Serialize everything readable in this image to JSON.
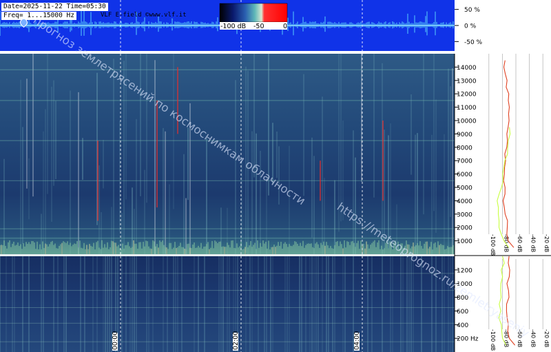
{
  "header": {
    "date_line": "Date=2025-11-22 Time=05:30",
    "freq_line": "Freq= 1...15000 Hz",
    "source": "VLF E-field ©www.vlf.it"
  },
  "colorbar": {
    "tick_labels": [
      "-100 dB",
      "-50",
      "0"
    ],
    "colors": [
      "#000000",
      "#0a1a6e",
      "#2a5fb0",
      "#5fb8b8",
      "#d8e8d0",
      "#ff3030",
      "#ff0000"
    ]
  },
  "watermark": {
    "line1": "прогноз землетрясений по космоснимкам облачности",
    "line2": "https://meteoprognoz.ru/zemletryaseniy"
  },
  "chart_data": [
    {
      "type": "line",
      "title": "",
      "panel": "waveform",
      "ytick_labels": [
        "50 %",
        "0 %",
        "-50 %"
      ],
      "yticks": [
        50,
        0,
        -50
      ],
      "ylim": [
        -75,
        75
      ],
      "background": "#1033e8",
      "line_color": "#5fe0ff"
    },
    {
      "type": "heatmap",
      "panel": "spectrogram-full",
      "ylim": [
        0,
        15000
      ],
      "yticks": [
        1000,
        2000,
        3000,
        4000,
        5000,
        6000,
        7000,
        8000,
        9000,
        10000,
        11000,
        12000,
        13000,
        14000
      ],
      "ytick_labels": [
        "1000",
        "2000",
        "3000",
        "4000",
        "5000",
        "6000",
        "7000",
        "8000",
        "9000",
        "10000",
        "11000",
        "12000",
        "13000",
        "14000"
      ],
      "time_marks": [
        "00:00",
        "02:00",
        "04:00"
      ]
    },
    {
      "type": "heatmap",
      "panel": "spectrogram-zoom",
      "ylim": [
        0,
        1400
      ],
      "yticks": [
        200,
        400,
        600,
        800,
        1000,
        1200
      ],
      "ytick_labels": [
        "200 Hz",
        "400",
        "600",
        "800",
        "1000",
        "1200"
      ],
      "xtick_labels": [
        "00:00",
        "02:00",
        "04:00"
      ]
    },
    {
      "type": "line",
      "panel": "spectrum-profile",
      "xtick_labels": [
        "-100 dB",
        "-80 dB",
        "-60 dB",
        "-40 dB",
        "-20 dB"
      ],
      "xticks": [
        -100,
        -80,
        -60,
        -40,
        -20
      ],
      "xlim": [
        -110,
        -10
      ],
      "series": [
        {
          "color": "#e04020",
          "freq": [
            500,
            1000,
            1500,
            2000,
            2500,
            3000,
            3500,
            4000,
            4500,
            5000,
            5500,
            6000,
            6500,
            7000,
            7500,
            8000,
            8500,
            9000,
            9500,
            10000,
            10500,
            11000,
            11500,
            12000,
            12500,
            13000,
            13500,
            14000,
            14500
          ],
          "db": [
            -64,
            -70,
            -72,
            -74,
            -74,
            -75,
            -76,
            -77,
            -77,
            -78,
            -77,
            -77,
            -76,
            -76,
            -75,
            -74,
            -73,
            -72,
            -72,
            -71,
            -71,
            -70,
            -71,
            -72,
            -73,
            -74,
            -75,
            -76,
            -77
          ]
        },
        {
          "color": "#c8ff40",
          "freq": [
            500,
            1000,
            1500,
            2000,
            2500,
            3000,
            3500,
            4000,
            4500,
            5000,
            5500,
            6000,
            6500,
            7000,
            7500,
            8000,
            8500,
            9000,
            9500
          ],
          "db": [
            -70,
            -76,
            -80,
            -83,
            -84,
            -86,
            -86,
            -87,
            -84,
            -82,
            -80,
            -79,
            -78,
            -76,
            -74,
            -71,
            -70,
            -70,
            -70
          ]
        }
      ]
    },
    {
      "type": "line",
      "panel": "spectrum-profile-zoom",
      "xtick_labels": [
        "-100 dB",
        "-80 dB",
        "-60 dB",
        "-40 dB",
        "-20 dB"
      ],
      "xticks": [
        -100,
        -80,
        -60,
        -40,
        -20
      ],
      "xlim": [
        -110,
        -10
      ],
      "series": [
        {
          "color": "#e04020",
          "freq": [
            100,
            200,
            300,
            400,
            500,
            600,
            700,
            800,
            900,
            1000,
            1100,
            1200,
            1300,
            1400
          ],
          "db": [
            -62,
            -70,
            -72,
            -71,
            -73,
            -72,
            -74,
            -71,
            -70,
            -72,
            -71,
            -70,
            -70,
            -72
          ]
        },
        {
          "color": "#c8ff40",
          "freq": [
            100,
            200,
            300,
            400,
            500,
            600,
            700,
            800,
            900,
            1000,
            1100,
            1200,
            1300,
            1400
          ],
          "db": [
            -74,
            -80,
            -82,
            -80,
            -84,
            -82,
            -83,
            -80,
            -82,
            -81,
            -80,
            -82,
            -78,
            -80
          ]
        }
      ]
    }
  ]
}
